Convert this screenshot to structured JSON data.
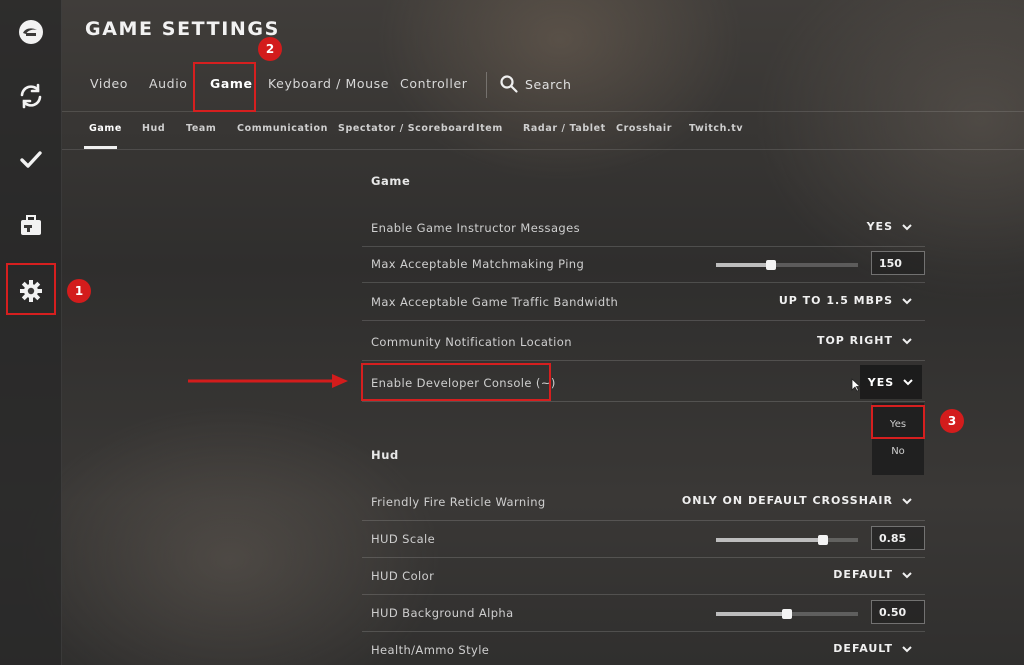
{
  "header": {
    "title": "GAME SETTINGS"
  },
  "sidebar": {
    "items": [
      {
        "name": "logo-icon"
      },
      {
        "name": "refresh-icon"
      },
      {
        "name": "checkmark-icon"
      },
      {
        "name": "inventory-briefcase-icon"
      },
      {
        "name": "settings-gear-icon"
      }
    ]
  },
  "main_tabs": {
    "items": [
      "Video",
      "Audio",
      "Game",
      "Keyboard / Mouse",
      "Controller"
    ],
    "active": "Game",
    "search_label": "Search"
  },
  "sub_tabs": {
    "items": [
      "Game",
      "Hud",
      "Team",
      "Communication",
      "Spectator / Scoreboard",
      "Item",
      "Radar / Tablet",
      "Crosshair",
      "Twitch.tv"
    ],
    "active": "Game"
  },
  "sections": {
    "game": {
      "title": "Game",
      "rows": [
        {
          "label": "Enable Game Instructor Messages",
          "value": "YES"
        },
        {
          "label": "Max Acceptable Matchmaking Ping",
          "value": "150",
          "slider_level": 0.39
        },
        {
          "label": "Max Acceptable Game Traffic Bandwidth",
          "value": "UP TO 1.5 MBPS"
        },
        {
          "label": "Community Notification Location",
          "value": "TOP RIGHT"
        },
        {
          "label": "Enable Developer Console (~)",
          "value": "YES"
        }
      ]
    },
    "hud": {
      "title": "Hud",
      "rows": [
        {
          "label": "Friendly Fire Reticle Warning",
          "value": "ONLY ON DEFAULT CROSSHAIR"
        },
        {
          "label": "HUD Scale",
          "value": "0.85",
          "slider_level": 0.75
        },
        {
          "label": "HUD Color",
          "value": "DEFAULT"
        },
        {
          "label": "HUD Background Alpha",
          "value": "0.50",
          "slider_level": 0.5
        },
        {
          "label": "Health/Ammo Style",
          "value": "DEFAULT"
        }
      ]
    }
  },
  "dropdown": {
    "current": "YES",
    "options": [
      "Yes",
      "No"
    ]
  },
  "annotations": {
    "badges": [
      "1",
      "2",
      "3"
    ],
    "color": "#d31c1c"
  }
}
